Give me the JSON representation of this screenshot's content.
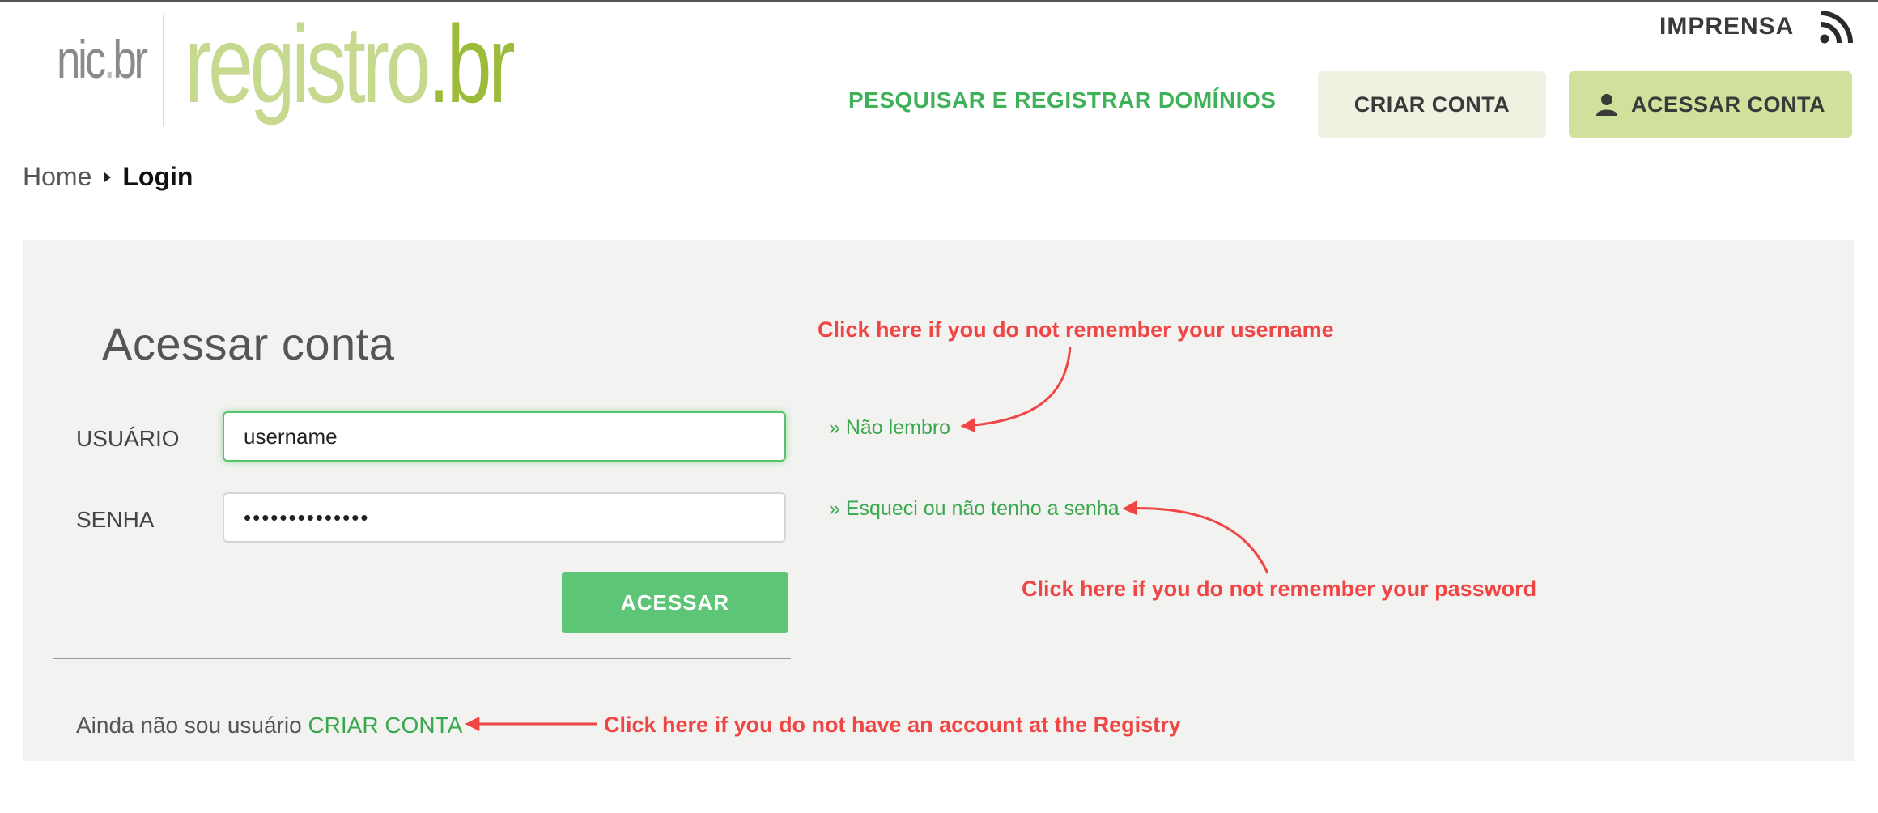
{
  "logo": {
    "nic": "nic",
    "nic_dot": ".",
    "nic_br": "br",
    "reg": "registro",
    "reg_dot": ".",
    "reg_br": "br"
  },
  "header": {
    "press_link": "IMPRENSA",
    "rss_icon": "rss-icon",
    "search_domains": "PESQUISAR E REGISTRAR DOMÍNIOS",
    "create_account": "CRIAR CONTA",
    "access_account": "ACESSAR CONTA",
    "user_icon": "user-icon"
  },
  "breadcrumb": {
    "home": "Home",
    "current": "Login"
  },
  "login": {
    "title": "Acessar conta",
    "username_label": "USUÁRIO",
    "username_value": "username",
    "password_label": "SENHA",
    "password_value": "••••••••••••••",
    "submit": "ACESSAR",
    "forgot_username": "» Não lembro",
    "forgot_password": "» Esqueci ou não tenho a senha",
    "no_account_text": "Ainda não sou usuário",
    "no_account_link": "CRIAR CONTA"
  },
  "annotations": {
    "username": "Click here if you do not remember your username",
    "password": "Click here if you do not remember your password",
    "account": "Click here if you do not have an account at the Registry"
  },
  "colors": {
    "brand_green": "#3fb158",
    "annotation_red": "#f04545",
    "submit_green": "#5dc576",
    "panel_bg": "#f2f2f0"
  }
}
